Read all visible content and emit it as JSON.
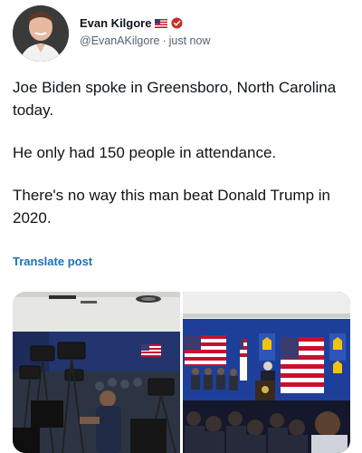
{
  "tweet": {
    "author_name": "Evan Kilgore",
    "handle": "@EvanAKilgore",
    "separator": "·",
    "time": "just now",
    "paragraphs": [
      "Joe Biden spoke in Greensboro, North Carolina today.",
      "He only had 150 people in attendance.",
      "There's no way this man beat Donald Trump in 2020."
    ],
    "translate_label": "Translate post"
  },
  "icons": {
    "flag": "us-flag-icon",
    "verified": "verified-badge-icon"
  },
  "colors": {
    "link": "#1d70b8",
    "secondary_text": "#536471",
    "verified_badge": "#c4302b"
  }
}
